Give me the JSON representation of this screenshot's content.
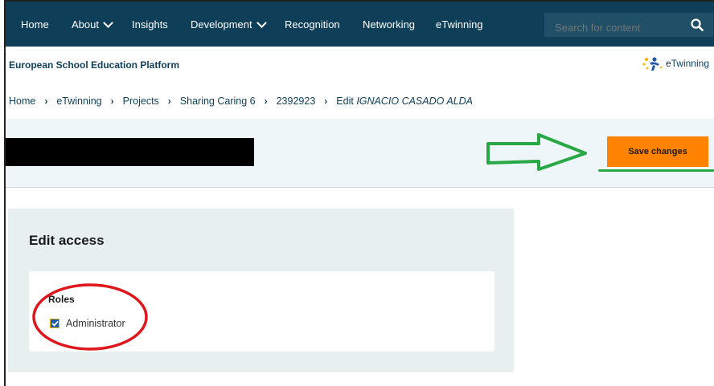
{
  "nav": {
    "items": [
      {
        "label": "Home",
        "has_dropdown": false
      },
      {
        "label": "About",
        "has_dropdown": true
      },
      {
        "label": "Insights",
        "has_dropdown": false
      },
      {
        "label": "Development",
        "has_dropdown": true
      },
      {
        "label": "Recognition",
        "has_dropdown": false
      },
      {
        "label": "Networking",
        "has_dropdown": false
      },
      {
        "label": "eTwinning",
        "has_dropdown": false
      }
    ],
    "search_placeholder": "Search for content",
    "search_icon": "magnifier-icon"
  },
  "platform": {
    "title": "European School Education Platform",
    "logo_text": "eTwinning"
  },
  "breadcrumb": {
    "items": [
      "Home",
      "eTwinning",
      "Projects",
      "Sharing Caring 6",
      "2392923"
    ],
    "last_prefix": "Edit",
    "last_name": "IGNACIO CASADO ALDA"
  },
  "header": {
    "save_label": "Save changes"
  },
  "card": {
    "title": "Edit access",
    "roles_label": "Roles",
    "role_option": "Administrator",
    "role_checked": true
  },
  "colors": {
    "nav_bg": "#0e3e58",
    "accent_orange": "#ff8200",
    "annotation_green": "#28a745",
    "annotation_red": "#e0161d",
    "checkbox_blue": "#1d5aa8"
  }
}
